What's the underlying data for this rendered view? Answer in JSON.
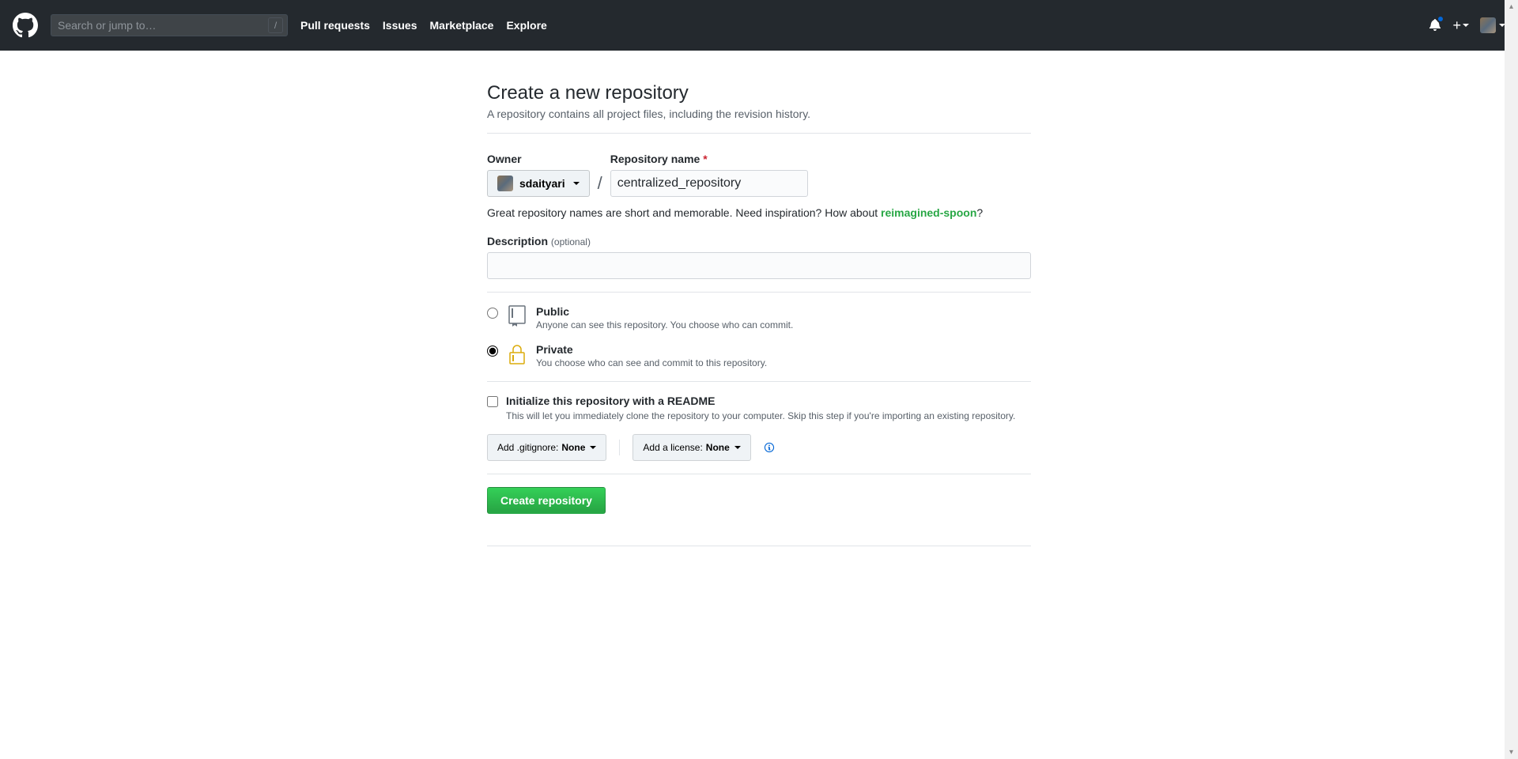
{
  "header": {
    "search_placeholder": "Search or jump to…",
    "nav": [
      "Pull requests",
      "Issues",
      "Marketplace",
      "Explore"
    ]
  },
  "page": {
    "title": "Create a new repository",
    "subtitle": "A repository contains all project files, including the revision history."
  },
  "form": {
    "owner_label": "Owner",
    "owner_value": "sdaityari",
    "repo_label": "Repository name",
    "repo_value": "centralized_repository",
    "hint_prefix": "Great repository names are short and memorable. Need inspiration? How about ",
    "suggestion": "reimagined-spoon",
    "hint_suffix": "?",
    "desc_label": "Description",
    "desc_optional": "(optional)",
    "visibility": {
      "public": {
        "title": "Public",
        "desc": "Anyone can see this repository. You choose who can commit."
      },
      "private": {
        "title": "Private",
        "desc": "You choose who can see and commit to this repository."
      }
    },
    "readme": {
      "label": "Initialize this repository with a README",
      "desc": "This will let you immediately clone the repository to your computer. Skip this step if you're importing an existing repository."
    },
    "gitignore": {
      "prefix": "Add .gitignore: ",
      "value": "None"
    },
    "license": {
      "prefix": "Add a license: ",
      "value": "None"
    },
    "submit": "Create repository"
  }
}
